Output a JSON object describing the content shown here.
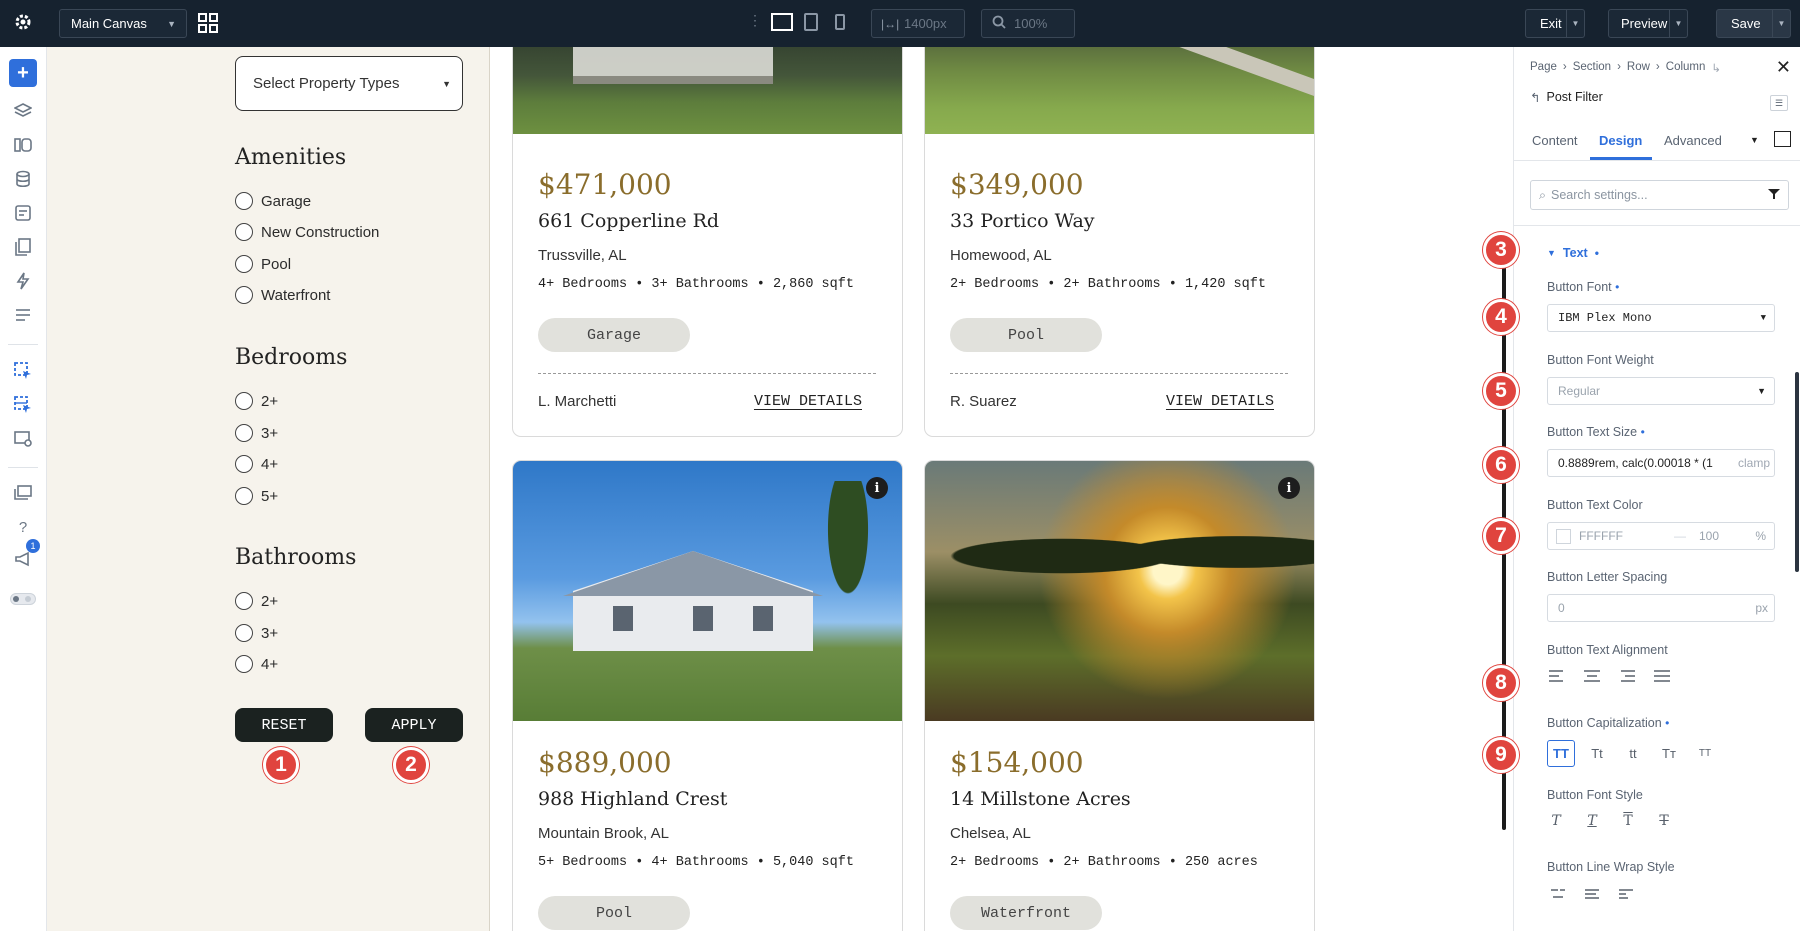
{
  "topbar": {
    "canvas_select": "Main Canvas",
    "width_value": "1400px",
    "zoom_value": "100%",
    "exit_label": "Exit",
    "preview_label": "Preview",
    "save_label": "Save"
  },
  "filters": {
    "property_select": "Select Property Types",
    "amenities_title": "Amenities",
    "amenities": [
      "Garage",
      "New Construction",
      "Pool",
      "Waterfront"
    ],
    "bedrooms_title": "Bedrooms",
    "bedrooms": [
      "2+",
      "3+",
      "4+",
      "5+"
    ],
    "bathrooms_title": "Bathrooms",
    "bathrooms": [
      "2+",
      "3+",
      "4+"
    ],
    "reset_label": "RESET",
    "apply_label": "APPLY"
  },
  "listings": [
    {
      "price": "$471,000",
      "address": "661 Copperline Rd",
      "city": "Trussville, AL",
      "specs": "4+ Bedrooms • 3+ Bathrooms • 2,860 sqft",
      "tag": "Garage",
      "agent": "L. Marchetti",
      "cta": "VIEW DETAILS"
    },
    {
      "price": "$349,000",
      "address": "33 Portico Way",
      "city": "Homewood, AL",
      "specs": "2+ Bedrooms • 2+ Bathrooms • 1,420 sqft",
      "tag": "Pool",
      "agent": "R. Suarez",
      "cta": "VIEW DETAILS"
    },
    {
      "price": "$889,000",
      "address": "988 Highland Crest",
      "city": "Mountain Brook, AL",
      "specs": "5+ Bedrooms • 4+ Bathrooms • 5,040 sqft",
      "tag": "Pool"
    },
    {
      "price": "$154,000",
      "address": "14 Millstone Acres",
      "city": "Chelsea, AL",
      "specs": "2+ Bedrooms • 2+ Bathrooms • 250 acres",
      "tag": "Waterfront"
    }
  ],
  "panel": {
    "breadcrumb": [
      "Page",
      "Section",
      "Row",
      "Column"
    ],
    "module_title": "Post Filter",
    "tabs": [
      "Content",
      "Design",
      "Advanced"
    ],
    "search_placeholder": "Search settings...",
    "section_title": "Text",
    "button_font_label": "Button Font",
    "button_font_value": "IBM Plex Mono",
    "font_weight_label": "Button Font Weight",
    "font_weight_value": "Regular",
    "text_size_label": "Button Text Size",
    "text_size_value": "0.8889rem, calc(0.00018 * (1",
    "text_size_overflow": "clamp",
    "text_color_label": "Button Text Color",
    "text_color_value": "FFFFFF",
    "text_color_opacity": "100",
    "percent_unit": "%",
    "letter_spacing_label": "Button Letter Spacing",
    "letter_spacing_value": "0",
    "px_unit": "px",
    "alignment_label": "Button Text Alignment",
    "capitalization_label": "Button Capitalization",
    "cap_options": [
      "TT",
      "Tt",
      "tt",
      "Tт",
      "TT"
    ],
    "font_style_label": "Button Font Style",
    "style_options": [
      "T",
      "T",
      "T",
      "T"
    ],
    "line_wrap_label": "Button Line Wrap Style"
  },
  "annotations": [
    "1",
    "2",
    "3",
    "4",
    "5",
    "6",
    "7",
    "8",
    "9"
  ],
  "notification_count": "1",
  "colors": {
    "accent": "#2f6fdb",
    "badge": "#e0443e",
    "price": "#8a6d2c",
    "topbar": "#16222f"
  }
}
